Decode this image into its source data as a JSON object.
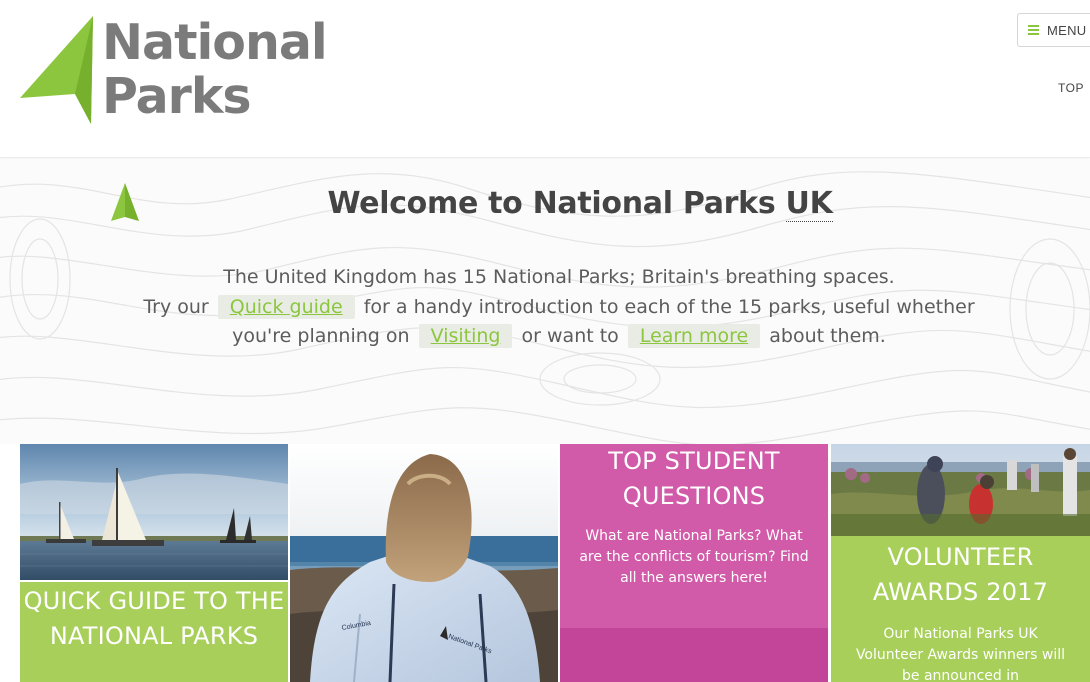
{
  "header": {
    "logo_line1": "National",
    "logo_line2": "Parks",
    "menu_label": "MENU",
    "top_link": "TOP"
  },
  "welcome": {
    "title_prefix": "Welcome to National Parks ",
    "title_abbr": "UK",
    "line1": "The United Kingdom has 15 National Parks; Britain's breathing spaces.",
    "line2_before": "Try our",
    "link_quick_guide": "Quick guide",
    "line2_after": "for a handy introduction to each of the 15 parks, useful whether",
    "line3_before": "you're planning on",
    "link_visiting": "Visiting",
    "line3_middle": "or want to",
    "link_learn_more": "Learn more",
    "line3_after": "about them."
  },
  "tiles": {
    "quick_guide_title": "QUICK GUIDE TO THE NATIONAL PARKS",
    "student_title": "TOP STUDENT QUESTIONS",
    "student_text": "What are National Parks? What are the conflicts of tourism? Find all the answers here!",
    "volunteer_title": "VOLUNTEER AWARDS 2017",
    "volunteer_text": "Our National Parks UK Volunteer Awards winners will be announced in",
    "jacket_brand": "Columbia",
    "jacket_badge": "National Parks"
  },
  "colors": {
    "brand_green": "#8cc63e",
    "tile_green": "#a7cf5a",
    "magenta": "#d15ba8",
    "magenta_dark": "#c2459a",
    "logo_grey": "#7b7b7b"
  }
}
